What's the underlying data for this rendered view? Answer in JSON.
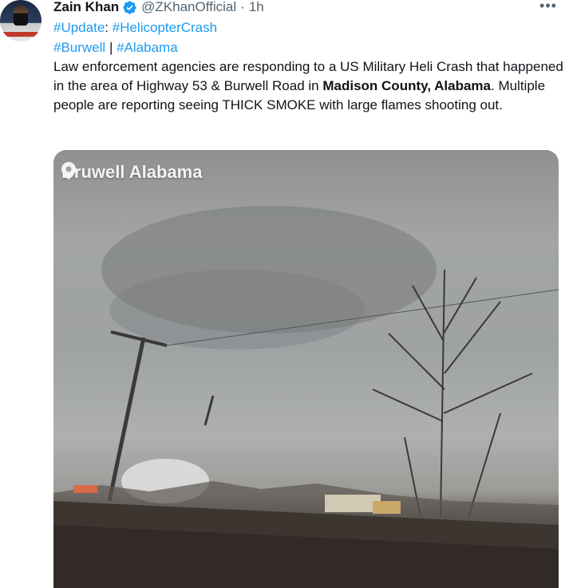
{
  "tweet": {
    "author_name": "Zain Khan",
    "handle": "@ZKhanOfficial",
    "separator": "·",
    "time": "1h",
    "more_icon": "more-horizontal-icon",
    "hashtags_line1": {
      "tag1": "#Update",
      "colon": ":",
      "tag2": "#HelicopterCrash"
    },
    "hashtags_line2": {
      "tag1": "#Burwell",
      "sep": "|",
      "tag2": "#Alabama"
    },
    "body": {
      "part1": "Law enforcement agencies are responding to a US Military Heli Crash that happened in the area of Highway 53 & Burwell Road in ",
      "bold1": "Madison County, Alabama",
      "part2": ". Multiple people are reporting seeing THICK SMOKE with large flames shooting out."
    },
    "media": {
      "location_label": "Bruwell Alabama",
      "location_icon": "map-pin-icon"
    }
  },
  "colors": {
    "link": "#1d9bf0",
    "text": "#0f1419",
    "secondary": "#536471",
    "verified": "#1d9bf0"
  }
}
